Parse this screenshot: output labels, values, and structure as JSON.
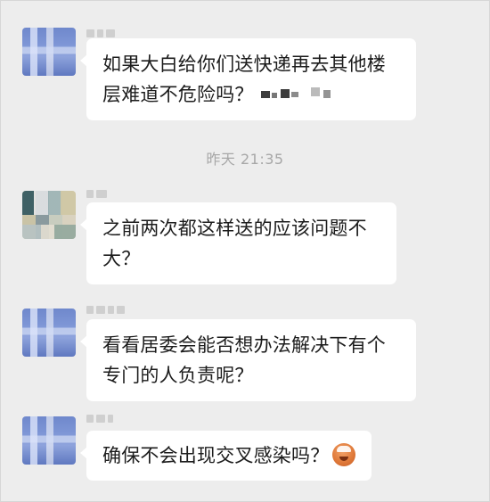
{
  "chat": {
    "messages": [
      {
        "lines": [
          "如果大白给你们送快递再去其他楼",
          "层难道不危险吗？"
        ],
        "has_redaction": true
      },
      {
        "lines": [
          "之前两次都这样送的应该问题不",
          "大？"
        ]
      },
      {
        "lines": [
          "看看居委会能否想办法解决下有个",
          "专门的人负责呢？"
        ]
      },
      {
        "lines": [
          "确保不会出现交叉感染吗？"
        ],
        "emoji": "fearful-face-emoji"
      }
    ],
    "timestamp": "昨天 21:35"
  },
  "colors": {
    "background": "#ededed",
    "bubble": "#ffffff",
    "text": "#1c1c1c",
    "timestamp": "#a7a7a7"
  }
}
